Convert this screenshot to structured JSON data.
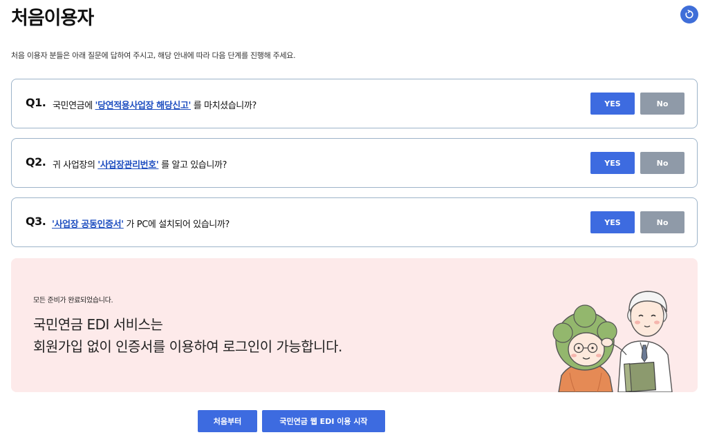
{
  "page": {
    "title": "처음이용자",
    "intro": "처음 이용자 분들은 아래 질문에 답하여 주시고, 해당 안내에 따라 다음 단계를 진행해 주세요.",
    "refresh_icon": "refresh-icon"
  },
  "questions": [
    {
      "number": "Q1.",
      "prefix": "국민연금에 ",
      "link": "'당연적용사업장 해당신고'",
      "suffix": " 를 마치셨습니까?",
      "yes_label": "YES",
      "no_label": "No"
    },
    {
      "number": "Q2.",
      "prefix": "귀 사업장의 ",
      "link": "'사업장관리번호'",
      "suffix": " 를 알고 있습니까?",
      "yes_label": "YES",
      "no_label": "No"
    },
    {
      "number": "Q3.",
      "prefix": "",
      "link": "'사업장 공동인증서'",
      "suffix": " 가 PC에 설치되어 있습니까?",
      "yes_label": "YES",
      "no_label": "No"
    }
  ],
  "done": {
    "small": "모든 준비가 완료되었습니다.",
    "line1": "국민연금 EDI 서비스는",
    "line2": "회원가입 없이 인증서를 이용하여 로그인이 가능합니다."
  },
  "actions": {
    "first_label": "처음부터",
    "start_label": "국민연금 웹 EDI 이용 시작"
  },
  "colors": {
    "primary": "#3d6be0",
    "secondary": "#8f9aa8",
    "card_border": "#9cb3c9",
    "done_bg": "#fdeaea",
    "link": "#1f4fc0"
  }
}
